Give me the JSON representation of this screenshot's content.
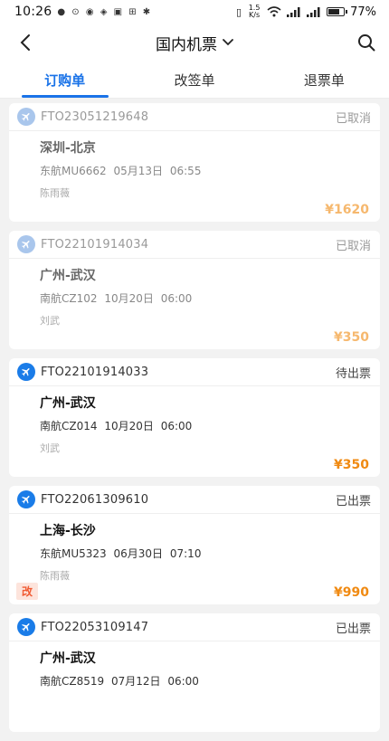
{
  "status_bar": {
    "time": "10:26",
    "net_speed": "1.5 K/s",
    "battery": "77%",
    "battery_level": 0.77
  },
  "header": {
    "title": "国内机票",
    "back_icon": "back-arrow-icon",
    "search_icon": "search-icon"
  },
  "tabs": [
    {
      "label": "订购单",
      "active": true
    },
    {
      "label": "改签单",
      "active": false
    },
    {
      "label": "退票单",
      "active": false
    }
  ],
  "orders": [
    {
      "order_no": "FTO23051219648",
      "status": "已取消",
      "route": "深圳-北京",
      "flight": "东航MU6662",
      "date": "05月13日 06:55",
      "passenger": "陈雨薇",
      "price": "¥1620",
      "tag": "",
      "muted": true
    },
    {
      "order_no": "FTO22101914034",
      "status": "已取消",
      "route": "广州-武汉",
      "flight": "南航CZ102",
      "date": "10月20日 06:00",
      "passenger": "刘武",
      "price": "¥350",
      "tag": "",
      "muted": true
    },
    {
      "order_no": "FTO22101914033",
      "status": "待出票",
      "route": "广州-武汉",
      "flight": "南航CZ014",
      "date": "10月20日 06:00",
      "passenger": "刘武",
      "price": "¥350",
      "tag": "",
      "muted": false
    },
    {
      "order_no": "FTO22061309610",
      "status": "已出票",
      "route": "上海-长沙",
      "flight": "东航MU5323",
      "date": "06月30日 07:10",
      "passenger": "陈雨薇",
      "price": "¥990",
      "tag": "改",
      "muted": false
    },
    {
      "order_no": "FTO22053109147",
      "status": "已出票",
      "route": "广州-武汉",
      "flight": "南航CZ8519",
      "date": "07月12日 06:00",
      "passenger": "",
      "price": "",
      "tag": "",
      "muted": false
    }
  ],
  "colors": {
    "accent": "#1a73e8",
    "price": "#f08a12",
    "tag_bg": "#fde4dc",
    "tag_text": "#f05a32"
  }
}
